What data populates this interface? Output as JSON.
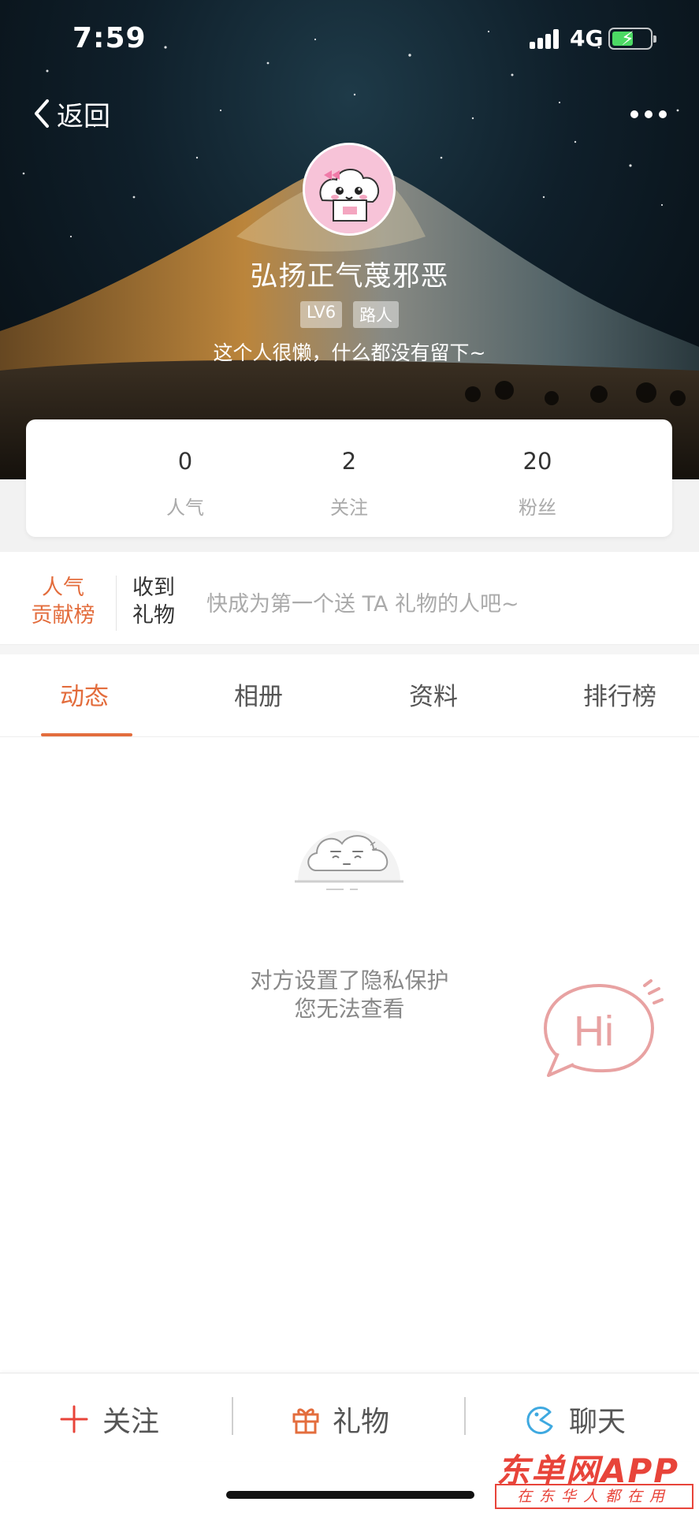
{
  "status_bar": {
    "time": "7:59",
    "network": "4G"
  },
  "header": {
    "back_label": "返回"
  },
  "profile": {
    "nickname": "弘扬正气蔑邪恶",
    "level_tag": "LV6",
    "role_tag": "路人",
    "bio": "这个人很懒，什么都没有留下~"
  },
  "stats": [
    {
      "value": "0",
      "label": "人气"
    },
    {
      "value": "2",
      "label": "关注"
    },
    {
      "value": "20",
      "label": "粉丝"
    }
  ],
  "gifts": {
    "rank_line1": "人气",
    "rank_line2": "贡献榜",
    "received_line1": "收到",
    "received_line2": "礼物",
    "hint": "快成为第一个送 TA 礼物的人吧~"
  },
  "tabs": [
    {
      "label": "动态",
      "active": true
    },
    {
      "label": "相册",
      "active": false
    },
    {
      "label": "资料",
      "active": false
    },
    {
      "label": "排行榜",
      "active": false
    }
  ],
  "empty_state": {
    "line1": "对方设置了隐私保护",
    "line2": "您无法查看"
  },
  "hi_bubble": {
    "text": "Hi"
  },
  "bottom_actions": [
    {
      "label": "关注",
      "icon": "plus-icon",
      "color": "#e8443a"
    },
    {
      "label": "礼物",
      "icon": "gift-icon",
      "color": "#e36d3d"
    },
    {
      "label": "聊天",
      "icon": "chat-icon",
      "color": "#3fa9e0"
    }
  ],
  "watermark": {
    "title": "东单网APP",
    "subtitle": "在东华人都在用"
  },
  "colors": {
    "accent": "#e36d3d",
    "muted": "#aaaaaa",
    "hi_pink": "#e8a2a2"
  }
}
